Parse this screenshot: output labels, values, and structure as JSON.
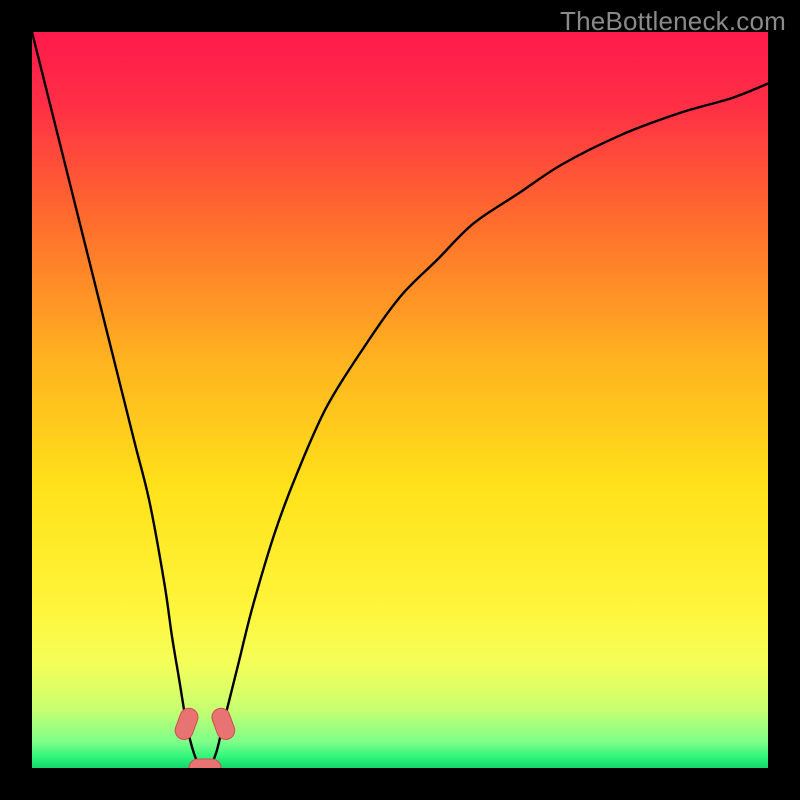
{
  "watermark": "TheBottleneck.com",
  "colors": {
    "frame": "#000000",
    "curve": "#000000",
    "marker_fill": "#e97272",
    "marker_stroke": "#c95050",
    "gradient_stops": [
      {
        "offset": 0.0,
        "color": "#ff1a4b"
      },
      {
        "offset": 0.1,
        "color": "#ff2f45"
      },
      {
        "offset": 0.25,
        "color": "#ff6a2e"
      },
      {
        "offset": 0.45,
        "color": "#ffb41f"
      },
      {
        "offset": 0.62,
        "color": "#ffe21a"
      },
      {
        "offset": 0.78,
        "color": "#fff53a"
      },
      {
        "offset": 0.86,
        "color": "#f4ff5a"
      },
      {
        "offset": 0.92,
        "color": "#c8ff70"
      },
      {
        "offset": 0.965,
        "color": "#7dff8a"
      },
      {
        "offset": 0.985,
        "color": "#30f57a"
      },
      {
        "offset": 1.0,
        "color": "#12d66a"
      }
    ]
  },
  "chart_data": {
    "type": "line",
    "title": "",
    "xlabel": "",
    "ylabel": "",
    "xlim": [
      0,
      100
    ],
    "ylim": [
      0,
      100
    ],
    "grid": false,
    "legend": false,
    "series": [
      {
        "name": "bottleneck-curve",
        "x": [
          0,
          2,
          4,
          6,
          8,
          10,
          12,
          14,
          16,
          18,
          19,
          20,
          21,
          22,
          23,
          24,
          25,
          26,
          28,
          30,
          33,
          36,
          40,
          45,
          50,
          55,
          60,
          66,
          72,
          80,
          88,
          95,
          100
        ],
        "y": [
          100,
          92,
          84,
          76,
          68,
          60,
          52,
          44,
          36,
          25,
          18,
          12,
          6,
          2,
          0,
          0,
          2,
          6,
          14,
          22,
          32,
          40,
          49,
          57,
          64,
          69,
          74,
          78,
          82,
          86,
          89,
          91,
          93
        ]
      }
    ],
    "markers": [
      {
        "x": 21.0,
        "y": 6.0,
        "rot": -70
      },
      {
        "x": 23.5,
        "y": 0.0,
        "rot": 0
      },
      {
        "x": 26.0,
        "y": 6.0,
        "rot": 70
      }
    ],
    "notch_x": 23.5
  }
}
